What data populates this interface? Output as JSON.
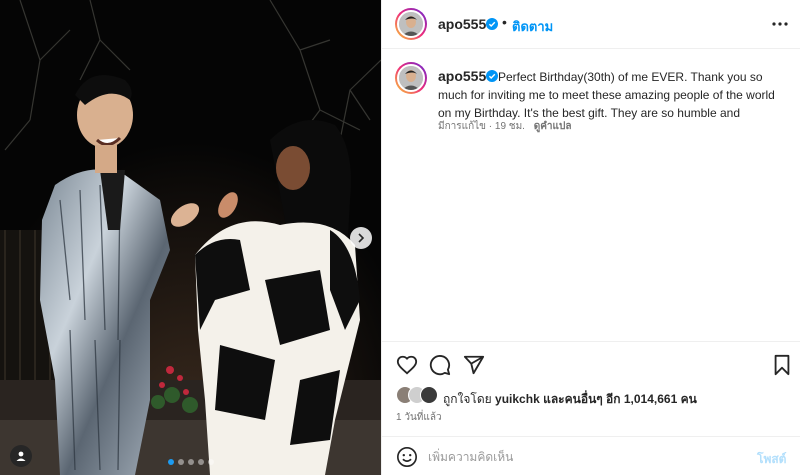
{
  "post": {
    "username": "apo555",
    "follow_label": "ติดตาม",
    "caption": "Perfect Birthday(30th) of me EVER. Thank you so much for inviting me to meet these amazing people of the world on my Birthday. It's the best gift. They are so humble and",
    "edited_label": "มีการแก้ไข · 19 ชม.",
    "translate_label": "ดูคำแปล",
    "likes": {
      "prefix": "ถูกใจโดย",
      "user": "yuikchk",
      "middle": "และคนอื่นๆ อีก",
      "count": "1,014,661",
      "suffix": "คน"
    },
    "time_ago": "1 วันที่แล้ว"
  },
  "comment": {
    "placeholder": "เพิ่มความคิดเห็น",
    "post_label": "โพสต์"
  },
  "carousel": {
    "slide_count": 5,
    "active_index": 0
  },
  "icons": {
    "verified": "verified-badge-icon",
    "more": "more-options-icon",
    "like": "heart-icon",
    "comment": "comment-bubble-icon",
    "share": "paper-plane-icon",
    "save": "bookmark-icon",
    "emoji": "smiley-icon",
    "next": "chevron-right-icon",
    "tag": "person-tag-icon"
  },
  "colors": {
    "accent": "#0095f6",
    "post_disabled": "#b2dffc",
    "carousel_active": "#1d9bf0"
  }
}
